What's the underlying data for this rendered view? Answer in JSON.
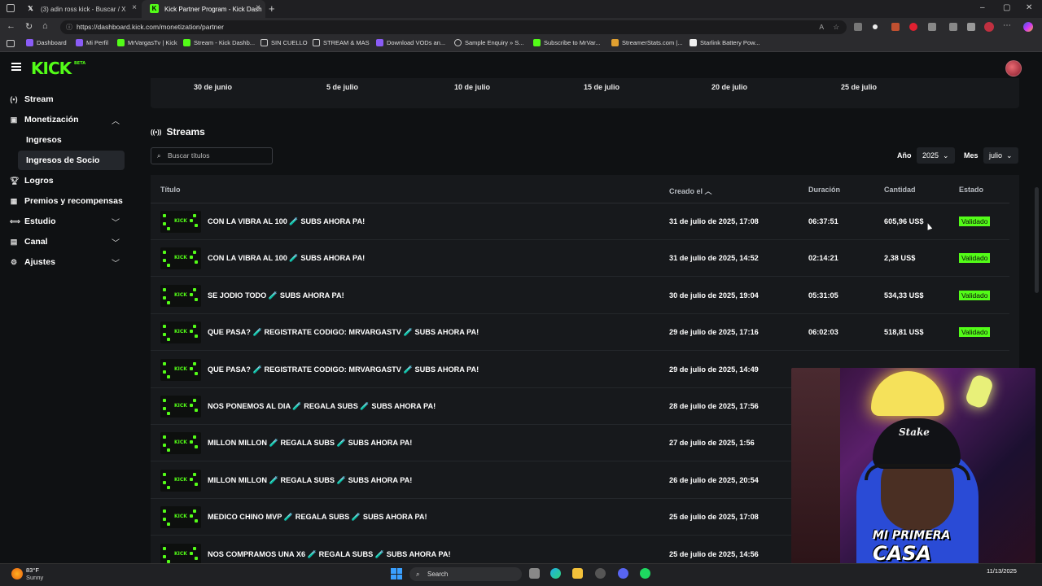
{
  "browser": {
    "tabs": [
      {
        "label": "(3) adin ross kick - Buscar / X",
        "icon": "x-icon"
      },
      {
        "label": "Kick Partner Program - Kick Dash",
        "icon": "kick-icon"
      }
    ],
    "url": "https://dashboard.kick.com/monetization/partner",
    "bookmarks": [
      "Dashboard",
      "Mi Perfil",
      "MrVargasTv | Kick",
      "Stream - Kick Dashb...",
      "SIN CUELLO",
      "STREAM & MAS",
      "Download VODs an...",
      "Sample Enquiry » S...",
      "Subscribe to MrVar...",
      "StreamerStats.com |...",
      "Starlink Battery Pow..."
    ]
  },
  "app": {
    "logo": "KICK",
    "logo_badge": "BETA"
  },
  "sidebar": {
    "items": [
      {
        "label": "Stream",
        "icon": "broadcast-icon"
      },
      {
        "label": "Monetización",
        "icon": "money-icon",
        "expanded": true
      },
      {
        "label": "Ingresos",
        "sub": true
      },
      {
        "label": "Ingresos de Socio",
        "sub": true,
        "active": true
      },
      {
        "label": "Logros",
        "icon": "trophy-icon"
      },
      {
        "label": "Premios y recompensas",
        "icon": "gift-icon"
      },
      {
        "label": "Estudio",
        "icon": "studio-icon"
      },
      {
        "label": "Canal",
        "icon": "channel-icon"
      },
      {
        "label": "Ajustes",
        "icon": "gear-icon"
      }
    ]
  },
  "chart_axis": {
    "ticks": [
      "30 de junio",
      "5 de julio",
      "10 de julio",
      "15 de julio",
      "20 de julio",
      "25 de julio"
    ]
  },
  "streams": {
    "heading": "Streams",
    "search_placeholder": "Buscar títulos",
    "year_label": "Año",
    "year_value": "2025",
    "month_label": "Mes",
    "month_value": "julio",
    "columns": {
      "title": "Título",
      "created": "Creado el",
      "duration": "Duración",
      "amount": "Cantidad",
      "status": "Estado"
    },
    "rows": [
      {
        "title": "CON LA VIBRA AL 100 🧪 SUBS AHORA PA!",
        "created": "31 de julio de 2025, 17:08",
        "duration": "06:37:51",
        "amount": "605,96 US$",
        "status": "Validado"
      },
      {
        "title": "CON LA VIBRA AL 100 🧪 SUBS AHORA PA!",
        "created": "31 de julio de 2025, 14:52",
        "duration": "02:14:21",
        "amount": "2,38 US$",
        "status": "Validado"
      },
      {
        "title": "SE JODIO TODO 🧪 SUBS AHORA PA!",
        "created": "30 de julio de 2025, 19:04",
        "duration": "05:31:05",
        "amount": "534,33 US$",
        "status": "Validado"
      },
      {
        "title": "QUE PASA? 🧪 REGISTRATE CODIGO: MRVARGASTV 🧪 SUBS AHORA PA!",
        "created": "29 de julio de 2025, 17:16",
        "duration": "06:02:03",
        "amount": "518,81 US$",
        "status": "Validado"
      },
      {
        "title": "QUE PASA? 🧪 REGISTRATE CODIGO: MRVARGASTV 🧪 SUBS AHORA PA!",
        "created": "29 de julio de 2025, 14:49",
        "duration": "",
        "amount": "",
        "status": ""
      },
      {
        "title": "NOS PONEMOS AL DIA 🧪 REGALA SUBS 🧪 SUBS AHORA PA!",
        "created": "28 de julio de 2025, 17:56",
        "duration": "",
        "amount": "",
        "status": ""
      },
      {
        "title": "MILLON MILLON 🧪 REGALA SUBS 🧪 SUBS AHORA PA!",
        "created": "27 de julio de 2025, 1:56",
        "duration": "",
        "amount": "",
        "status": ""
      },
      {
        "title": "MILLON MILLON 🧪 REGALA SUBS 🧪 SUBS AHORA PA!",
        "created": "26 de julio de 2025, 20:54",
        "duration": "",
        "amount": "",
        "status": ""
      },
      {
        "title": "MEDICO CHINO MVP 🧪 REGALA SUBS 🧪 SUBS AHORA PA!",
        "created": "25 de julio de 2025, 17:08",
        "duration": "",
        "amount": "",
        "status": ""
      },
      {
        "title": "NOS COMPRAMOS UNA X6 🧪 REGALA SUBS 🧪 SUBS AHORA PA!",
        "created": "25 de julio de 2025, 14:56",
        "duration": "",
        "amount": "",
        "status": ""
      }
    ]
  },
  "webcam": {
    "cap_text": "Stake",
    "watermark_line1": "MI PRIMERA",
    "watermark_line2": "CASA"
  },
  "taskbar": {
    "weather_temp": "83°F",
    "weather_desc": "Sunny",
    "search_label": "Search",
    "date": "11/13/2025"
  },
  "colors": {
    "accent": "#53fc18",
    "bg": "#0f1113",
    "panel": "#17191c"
  }
}
